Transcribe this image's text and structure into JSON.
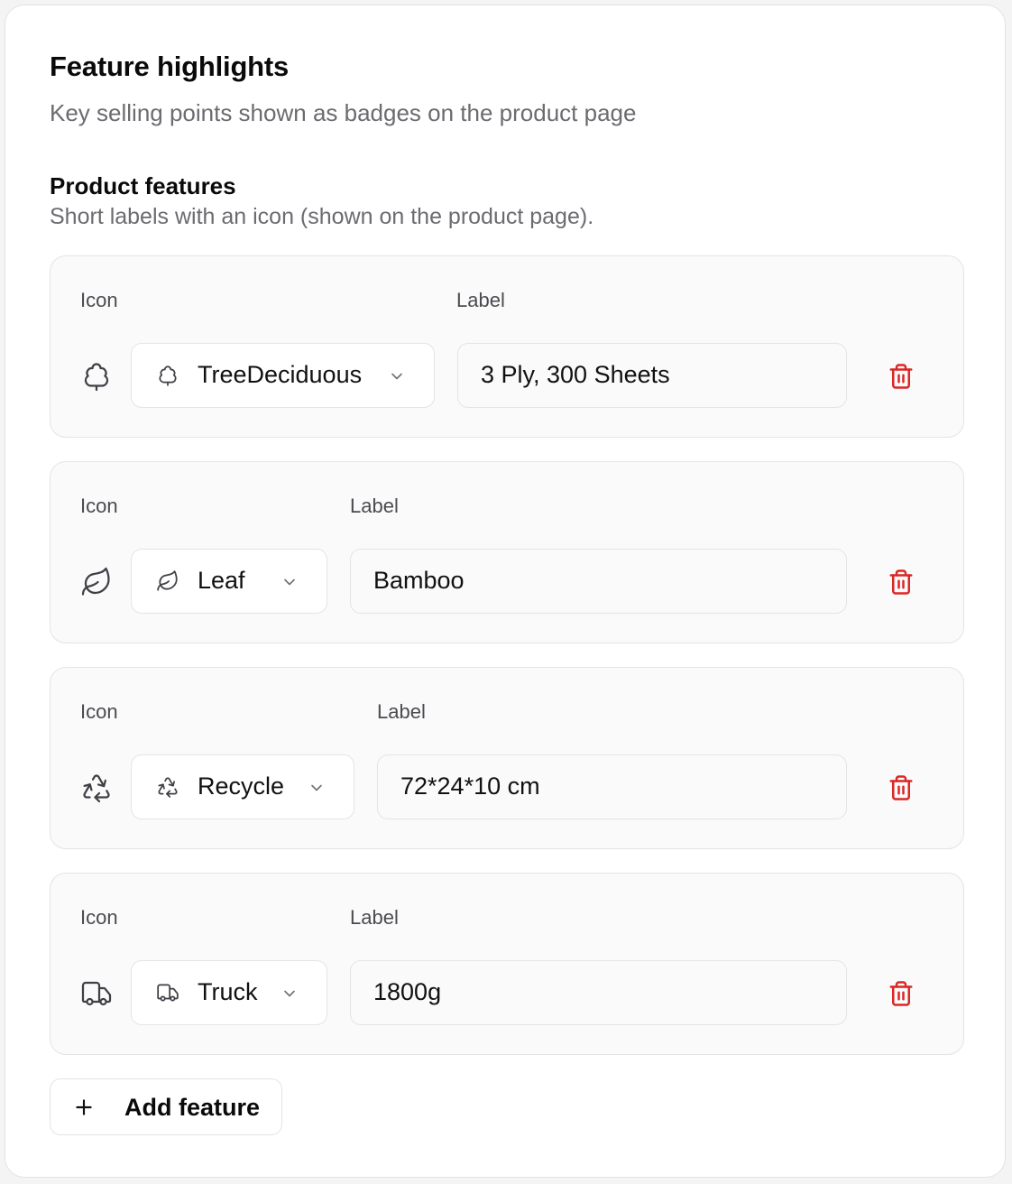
{
  "header": {
    "title": "Feature highlights",
    "subtitle": "Key selling points shown as badges on the product page"
  },
  "section": {
    "title": "Product features",
    "description": "Short labels with an icon (shown on the product page)."
  },
  "features": [
    {
      "icon_label": "Icon",
      "label_label": "Label",
      "icon": "tree-deciduous-icon",
      "icon_name": "TreeDeciduous",
      "value": "3 Ply, 300 Sheets"
    },
    {
      "icon_label": "Icon",
      "label_label": "Label",
      "icon": "leaf-icon",
      "icon_name": "Leaf",
      "value": "Bamboo"
    },
    {
      "icon_label": "Icon",
      "label_label": "Label",
      "icon": "recycle-icon",
      "icon_name": "Recycle",
      "value": "72*24*10 cm"
    },
    {
      "icon_label": "Icon",
      "label_label": "Label",
      "icon": "truck-icon",
      "icon_name": "Truck",
      "value": "1800g"
    }
  ],
  "add_button": {
    "label": "Add feature",
    "icon": "plus-icon"
  },
  "colors": {
    "danger": "#dc2626",
    "border": "#e4e4e7",
    "muted_text": "#6b6b70"
  }
}
